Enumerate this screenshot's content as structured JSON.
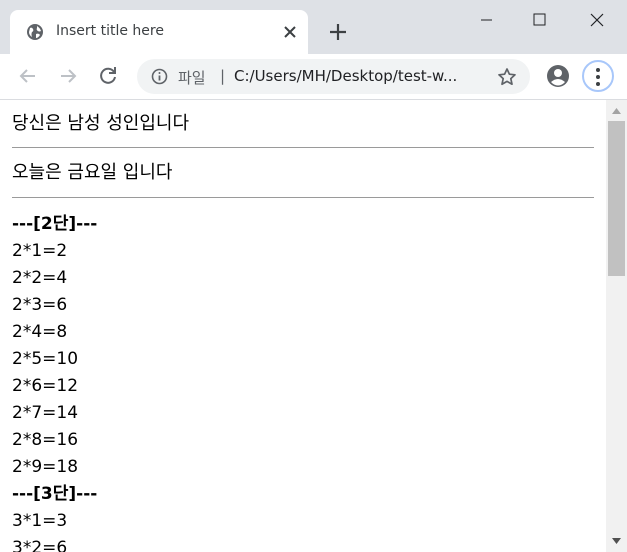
{
  "browser": {
    "tab": {
      "title": "Insert title here"
    },
    "omnibox": {
      "label": "파일",
      "separator": "|",
      "url": "C:/Users/MH/Desktop/test-w..."
    }
  },
  "page": {
    "message1": "당신은 남성 성인입니다",
    "message2": "오늘은 금요일 입니다",
    "tables": [
      {
        "header": "---[2단]---",
        "rows": [
          "2*1=2",
          "2*2=4",
          "2*3=6",
          "2*4=8",
          "2*5=10",
          "2*6=12",
          "2*7=14",
          "2*8=16",
          "2*9=18"
        ]
      },
      {
        "header": "---[3단]---",
        "rows": [
          "3*1=3",
          "3*2=6"
        ]
      }
    ]
  }
}
